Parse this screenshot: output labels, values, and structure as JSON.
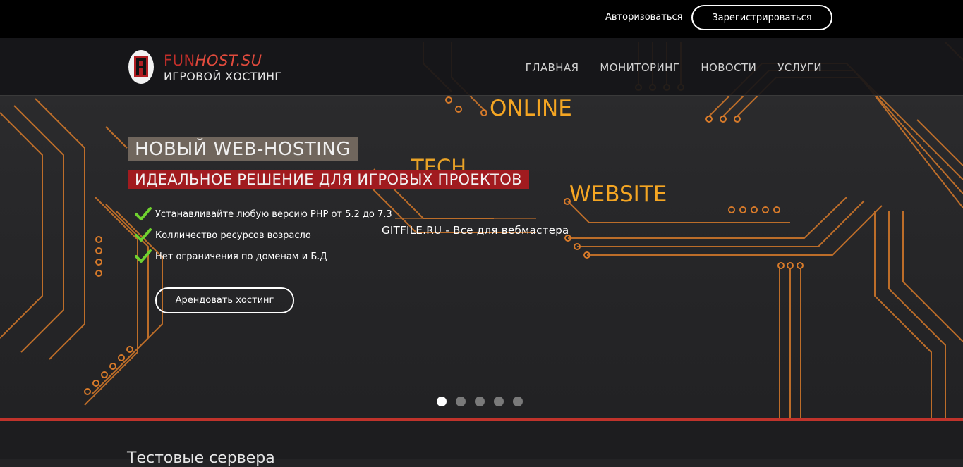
{
  "topbar": {
    "login_label": "Авторизоваться",
    "register_label": "Зарегистрироваться"
  },
  "logo": {
    "brand_part1": "FUN",
    "brand_part2": "HOST.SU",
    "subtitle": "ИГРОВОЙ ХОСТИНГ",
    "mark_icon": "fh-logo-icon"
  },
  "nav": {
    "items": [
      {
        "label": "ГЛАВНАЯ"
      },
      {
        "label": "МОНИТОРИНГ"
      },
      {
        "label": "НОВОСТИ"
      },
      {
        "label": "УСЛУГИ"
      }
    ]
  },
  "hero": {
    "title": "НОВЫЙ WEB-HOSTING",
    "subtitle": "ИДЕАЛЬНОЕ РЕШЕНИЕ ДЛЯ ИГРОВЫХ ПРОЕКТОВ",
    "features": [
      "Устанавливайте любую версию PHP от 5.2 до 7.3",
      "Колличество ресурсов возрасло",
      "Нет ограничения по доменам и Б.Д"
    ],
    "feature_icon": "green-check-icon",
    "cta_label": "Арендовать хостинг",
    "words": {
      "online": "ONLINE",
      "tech": "TECH",
      "website": "WEBSITE"
    },
    "watermark": "GITFILE.RU - Все для вебмастера",
    "slides_total": 5,
    "active_slide": 1
  },
  "section": {
    "title": "Тестовые сервера"
  },
  "colors": {
    "accent_red": "#c0332b",
    "circuit_orange": "#e0882c",
    "highlight_orange": "#f5a623",
    "check_green": "#6fd12f"
  }
}
